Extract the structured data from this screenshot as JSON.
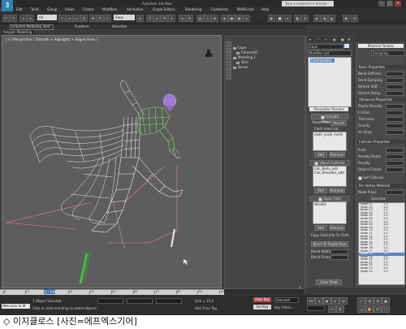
{
  "app": {
    "logo": "3",
    "window_title": "Autodesk 3ds Max",
    "search_placeholder": "Type a keyword or phrase",
    "window_buttons": [
      "–",
      "□",
      "×"
    ]
  },
  "menu": [
    "Edit",
    "Tools",
    "Group",
    "Views",
    "Create",
    "Modifiers",
    "Animation",
    "Graph Editors",
    "Rendering",
    "Customize",
    "MAXScript",
    "Help"
  ],
  "toolbar": {
    "selection_filter": "All",
    "view_dropdown": "View"
  },
  "ribbon": {
    "tabs": [
      "Graphite Modeling Tools",
      "Freeform",
      "Selection"
    ],
    "sub_label": "Polygon Modeling"
  },
  "viewport": {
    "label": "[+] [Perspective ] [Smooth + Highlights + Edged Faces ]"
  },
  "explorer": {
    "items": [
      {
        "label": "Cape",
        "indent": 1
      },
      {
        "label": "Camera01",
        "indent": 2
      },
      {
        "label": "Modeling 1",
        "indent": 1
      },
      {
        "label": "Skin",
        "indent": 2
      },
      {
        "label": "Bones",
        "indent": 1
      }
    ]
  },
  "command_panel": {
    "object_name": "Cape",
    "modifier_list": "Modifier List",
    "stack_item": "Cloth(nodes)",
    "simulation_header": "Simulation Params",
    "activate_button": "Activate Simulation",
    "reset_label": "Reset Pose",
    "record_label": "Record",
    "cloth_used_label": "Cloth Used List",
    "cloth_list": [
      "cloth_scale_mesh"
    ],
    "add_label": "Add",
    "remove_label": "Remove",
    "object_collision_label": "Object Collision",
    "collision_list": [
      "Coll_Body_add",
      "Coll_Shoulder_add"
    ],
    "apply_field_label": "Apply Field",
    "field_list": [
      "Wind01"
    ],
    "copy_label": "Copy Field Info To Cloth",
    "blend_label": "Blend To Target Pose",
    "blend_width_label": "Blend Width",
    "blend_frames_label": "Blend Frames",
    "clear_label": "Clear Plate"
  },
  "material_panel": {
    "header": "Material Params",
    "sim_dropdown": "Sampling",
    "cloth_props_header": "Basic Properties",
    "props": [
      "Bend Stiffness",
      "Bend Damping",
      "Stretch Stiff.",
      "Stretch Damp."
    ],
    "advanced_header": "Advanced Properties",
    "adv_props": [
      "Plastic Density",
      "Friction",
      "Thickness",
      "Gravity",
      "Air Drag"
    ],
    "collision_header": "Collision Properties",
    "col_props": [
      "Push",
      "Penalty Depth",
      "Penalty",
      "Object Friction"
    ],
    "self_collision_label": "Self Collision",
    "pin_header": "Per Vertex Material",
    "multi_label": "Node Props",
    "sub_label": "Selection",
    "groups": [
      {
        "name": "Node 01",
        "value": "1.0"
      },
      {
        "name": "Node 02",
        "value": "1.0"
      },
      {
        "name": "Node 03",
        "value": "1.0"
      },
      {
        "name": "Node 04",
        "value": "1.0"
      },
      {
        "name": "Node 05",
        "value": "1.0"
      },
      {
        "name": "Node 06",
        "value": "1.0"
      },
      {
        "name": "Node 07",
        "value": "1.0"
      },
      {
        "name": "Node 08",
        "value": "1.0"
      },
      {
        "name": "Node 09",
        "value": "1.0"
      },
      {
        "name": "Node 10",
        "value": "1.0"
      },
      {
        "name": "Node 11",
        "value": "1.0"
      },
      {
        "name": "Node 12",
        "value": "1.0"
      },
      {
        "name": "Node 13",
        "value": "1.0"
      },
      {
        "name": "Node 14",
        "value": "1.0"
      },
      {
        "name": "Node 15",
        "value": "1.0"
      },
      {
        "name": "Node 16",
        "value": "1.0"
      },
      {
        "name": "Node 17",
        "value": "1.0"
      },
      {
        "name": "Node 18",
        "value": "1.0"
      },
      {
        "name": "Node 19",
        "value": "1.0"
      },
      {
        "name": "Node 20",
        "value": "1.0"
      },
      {
        "name": "Node 21",
        "value": "1.0"
      },
      {
        "name": "Node 22",
        "value": "1.0"
      },
      {
        "name": "Node 23",
        "value": "1.0"
      },
      {
        "name": "Node 24",
        "value": "1.0"
      }
    ]
  },
  "timeline": {
    "frame": "0 / 100",
    "ticks": [
      "0",
      "10",
      "20",
      "30",
      "40",
      "50",
      "60",
      "70",
      "80",
      "90",
      "100"
    ]
  },
  "status": {
    "welcome": "Welcome to M",
    "selected": "1 Object Selected",
    "prompt": "Click or click-and-drag to select objects",
    "auto_key": "Auto Key",
    "set_key": "Set Key",
    "selected_dropdown": "Selected",
    "key_filters": "Key Filters...",
    "add_time_tag": "Add Time Tag",
    "grid": "Grid = 10.0"
  },
  "caption": "◇ 이지클로스 [사진=에프엑스기어]",
  "icons": [
    "max-logo-icon",
    "search-icon",
    "undo-icon",
    "redo-icon",
    "select-icon",
    "move-icon",
    "rotate-icon",
    "scale-icon",
    "render-icon",
    "play-icon",
    "stop-icon",
    "key-icon"
  ],
  "colors": {
    "viewport_bg": "#5d5d5d",
    "wire": "#e8e8e8",
    "selected_wire": "#7dde5a",
    "head": "#9a7bd0",
    "accent": "#3e74b8"
  }
}
